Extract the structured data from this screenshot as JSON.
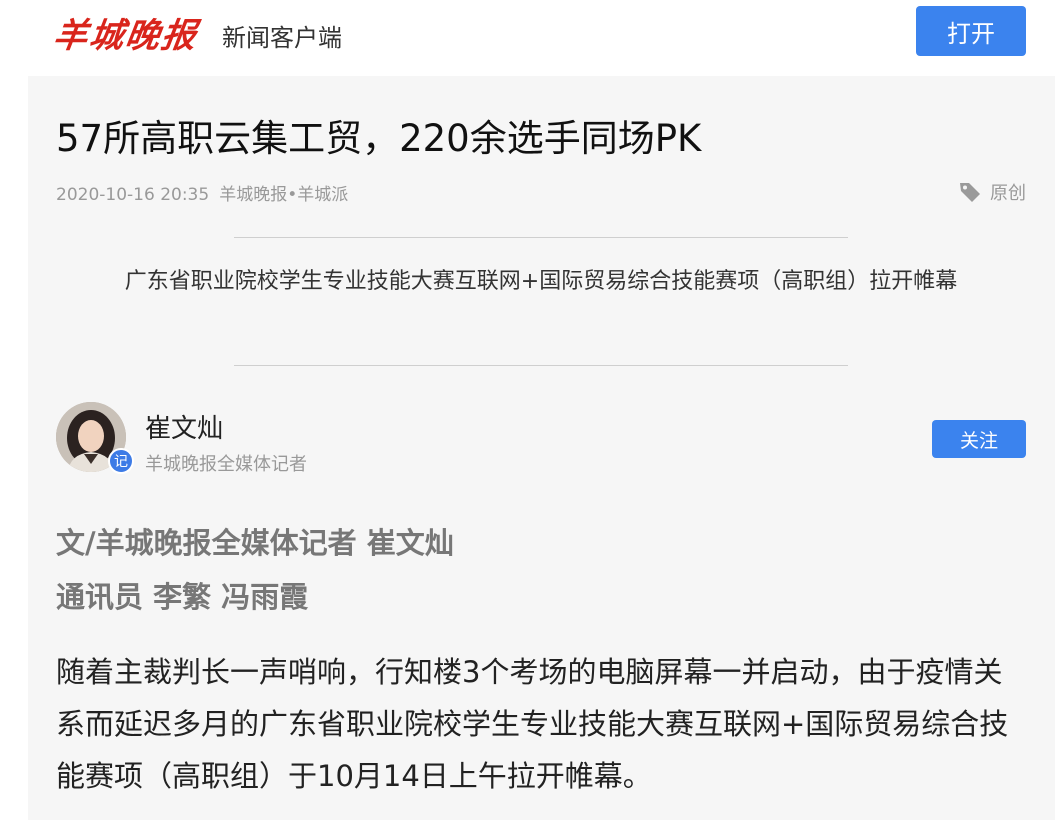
{
  "header": {
    "logo_text": "羊城晚报",
    "subtitle": "新闻客户端",
    "open_label": "打开"
  },
  "article": {
    "title": "57所高职云集工贸，220余选手同场PK",
    "date": "2020-10-16 20:35",
    "source": "羊城晚报•羊城派",
    "tag_label": "原创",
    "subtitle": "广东省职业院校学生专业技能大赛互联网+国际贸易综合技能赛项（高职组）拉开帷幕"
  },
  "author": {
    "name": "崔文灿",
    "description": "羊城晚报全媒体记者",
    "badge_char": "记",
    "follow_label": "关注"
  },
  "bylines": {
    "line1": "文/羊城晚报全媒体记者 崔文灿",
    "line2": "通讯员 李繁 冯雨霞"
  },
  "body": {
    "paragraph1": "随着主裁判长一声哨响，行知楼3个考场的电脑屏幕一并启动，由于疫情关系而延迟多月的广东省职业院校学生专业技能大赛互联网+国际贸易综合技能赛项（高职组）于10月14日上午拉开帷幕。"
  },
  "colors": {
    "brand_red": "#d9251c",
    "accent_blue": "#3b83ee",
    "panel_bg": "#f6f6f6"
  }
}
